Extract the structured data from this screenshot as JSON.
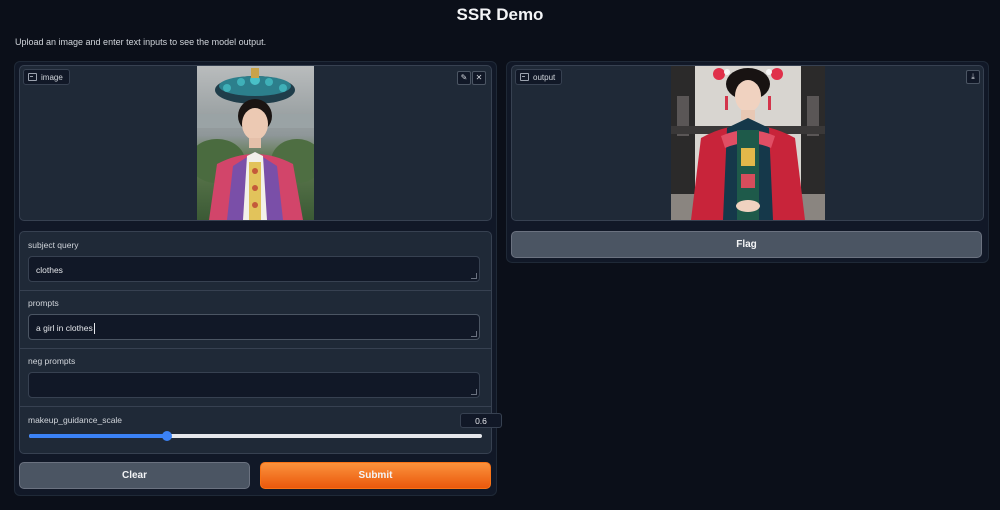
{
  "app": {
    "title": "SSR Demo",
    "description": "Upload an image and enter text inputs to see the model output."
  },
  "input_image": {
    "label": "image",
    "label_icon": "image-icon",
    "edit_icon": "pencil-icon",
    "clear_icon": "close-icon"
  },
  "form": {
    "subject_query": {
      "label": "subject query",
      "value": "clothes"
    },
    "prompts": {
      "label": "prompts",
      "value": "a girl in clothes"
    },
    "neg_prompts": {
      "label": "neg prompts",
      "value": ""
    },
    "makeup_guidance_scale": {
      "label": "makeup_guidance_scale",
      "value": 0.6,
      "display": "0.6",
      "fraction": 0.305
    }
  },
  "buttons": {
    "clear": "Clear",
    "submit": "Submit",
    "flag": "Flag"
  },
  "output": {
    "label": "output",
    "label_icon": "image-icon",
    "download_icon": "download-icon"
  },
  "colors": {
    "background": "#0b0f19",
    "panel": "#1f2937",
    "submit": "#f97316",
    "slider": "#3b82f6"
  }
}
